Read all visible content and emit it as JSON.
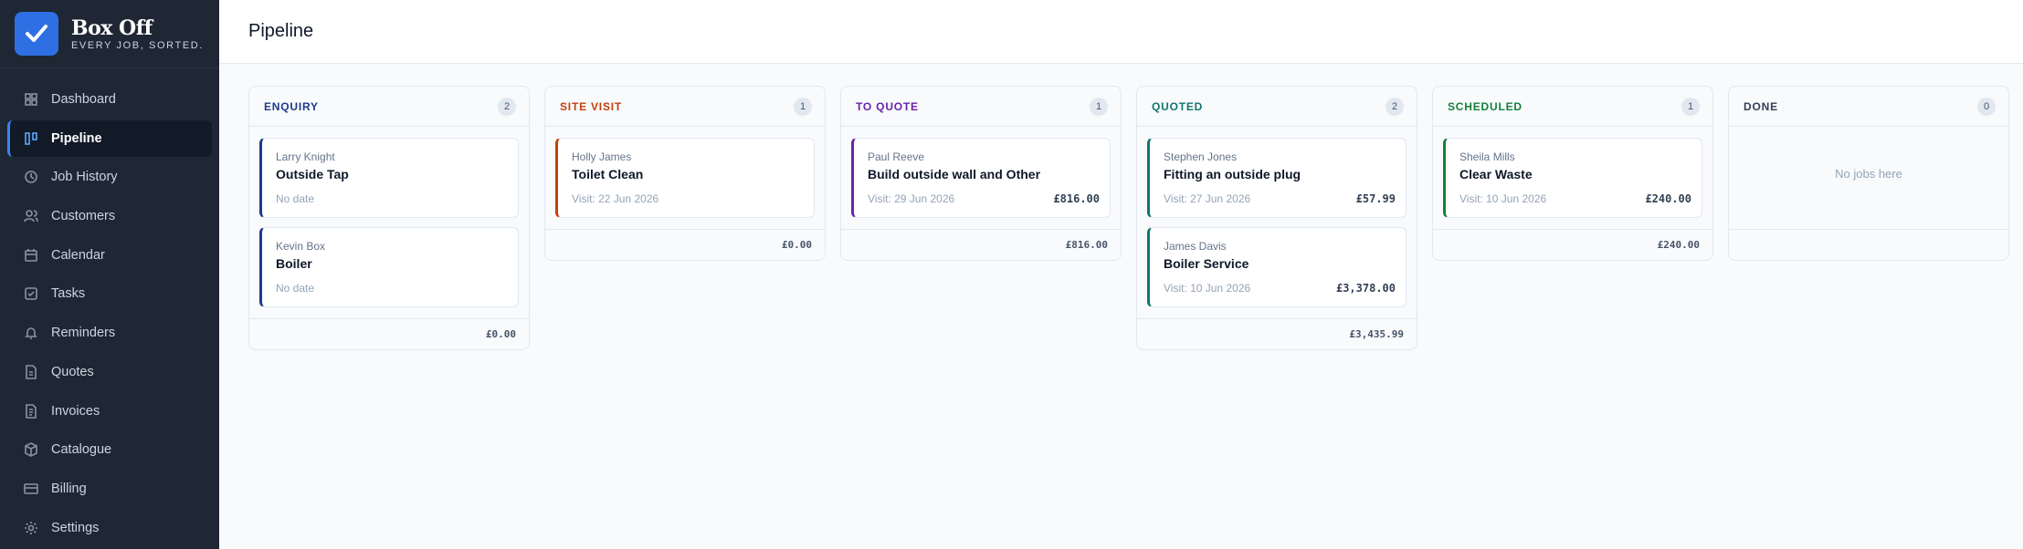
{
  "brand": {
    "name": "Box Off",
    "tagline": "EVERY JOB, SORTED."
  },
  "nav": [
    {
      "label": "Dashboard",
      "icon": "grid-icon",
      "active": false
    },
    {
      "label": "Pipeline",
      "icon": "kanban-icon",
      "active": true
    },
    {
      "label": "Job History",
      "icon": "history-icon",
      "active": false
    },
    {
      "label": "Customers",
      "icon": "users-icon",
      "active": false
    },
    {
      "label": "Calendar",
      "icon": "calendar-icon",
      "active": false
    },
    {
      "label": "Tasks",
      "icon": "check-square-icon",
      "active": false
    },
    {
      "label": "Reminders",
      "icon": "bell-icon",
      "active": false
    },
    {
      "label": "Quotes",
      "icon": "document-icon",
      "active": false
    },
    {
      "label": "Invoices",
      "icon": "invoice-icon",
      "active": false
    },
    {
      "label": "Catalogue",
      "icon": "box-icon",
      "active": false
    },
    {
      "label": "Billing",
      "icon": "credit-card-icon",
      "active": false
    },
    {
      "label": "Settings",
      "icon": "gear-icon",
      "active": false
    }
  ],
  "page": {
    "title": "Pipeline"
  },
  "columns": [
    {
      "title": "ENQUIRY",
      "count": "2",
      "color": "#1e3a8a",
      "total": "£0.00",
      "cards": [
        {
          "customer": "Larry Knight",
          "title": "Outside Tap",
          "date": "No date",
          "amount": ""
        },
        {
          "customer": "Kevin Box",
          "title": "Boiler",
          "date": "No date",
          "amount": ""
        }
      ]
    },
    {
      "title": "SITE VISIT",
      "count": "1",
      "color": "#c2410c",
      "total": "£0.00",
      "cards": [
        {
          "customer": "Holly James",
          "title": "Toilet Clean",
          "date": "Visit: 22 Jun 2026",
          "amount": ""
        }
      ]
    },
    {
      "title": "TO QUOTE",
      "count": "1",
      "color": "#6b21a8",
      "total": "£816.00",
      "cards": [
        {
          "customer": "Paul Reeve",
          "title": "Build outside wall and Other",
          "date": "Visit: 29 Jun 2026",
          "amount": "£816.00"
        }
      ]
    },
    {
      "title": "QUOTED",
      "count": "2",
      "color": "#0f766e",
      "total": "£3,435.99",
      "cards": [
        {
          "customer": "Stephen Jones",
          "title": "Fitting an outside plug",
          "date": "Visit: 27 Jun 2026",
          "amount": "£57.99"
        },
        {
          "customer": "James Davis",
          "title": "Boiler Service",
          "date": "Visit: 10 Jun 2026",
          "amount": "£3,378.00"
        }
      ]
    },
    {
      "title": "SCHEDULED",
      "count": "1",
      "color": "#15803d",
      "total": "£240.00",
      "cards": [
        {
          "customer": "Sheila Mills",
          "title": "Clear Waste",
          "date": "Visit: 10 Jun 2026",
          "amount": "£240.00"
        }
      ]
    },
    {
      "title": "DONE",
      "count": "0",
      "color": "#334155",
      "total": "",
      "empty_text": "No jobs here",
      "cards": []
    }
  ]
}
